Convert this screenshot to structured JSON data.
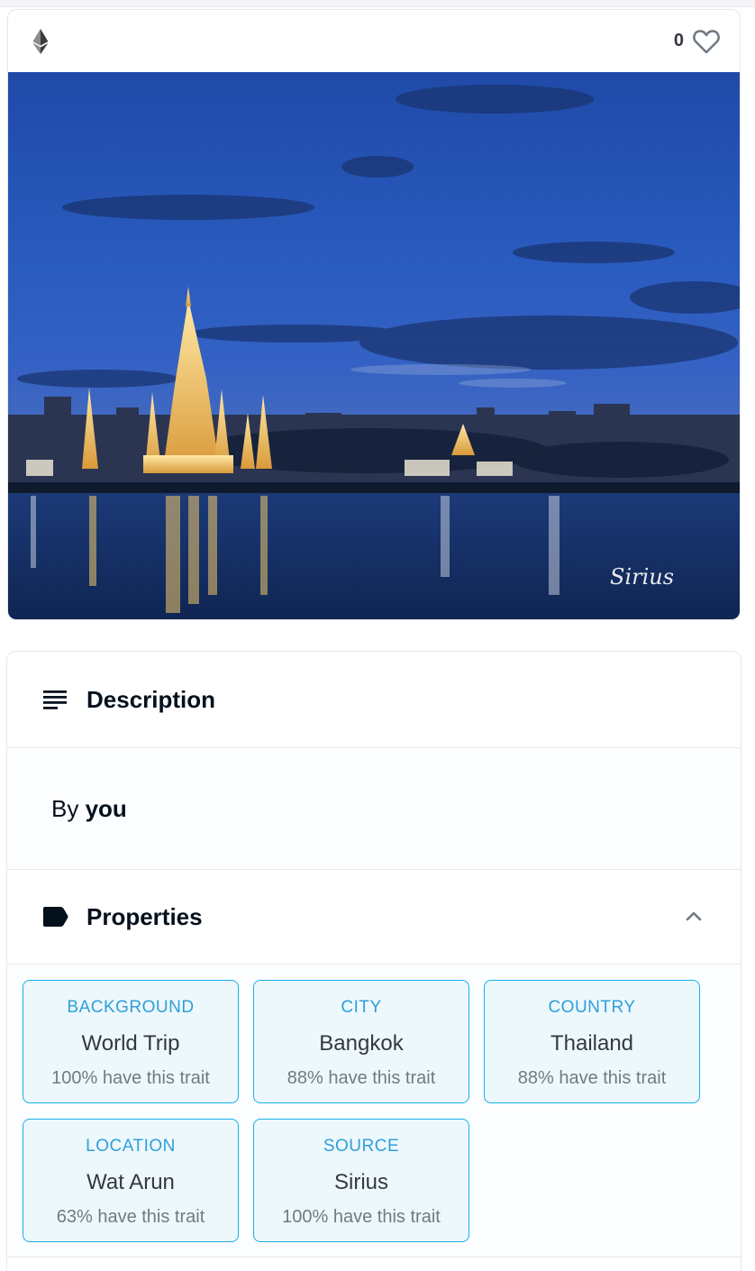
{
  "item": {
    "chain_icon": "ethereum-icon",
    "favorites": {
      "count": "0",
      "icon": "heart-outline-icon"
    },
    "image": {
      "subject": "Wat Arun temple lit at dusk beside the Chao Phraya river",
      "signature": "Sirius"
    }
  },
  "description": {
    "icon": "list-lines-icon",
    "title": "Description",
    "by_label": "By",
    "owner": "you"
  },
  "properties": {
    "icon": "tag-icon",
    "title": "Properties",
    "toggle_icon": "chevron-up-icon",
    "items": [
      {
        "type": "BACKGROUND",
        "value": "World Trip",
        "rarity": "100% have this trait"
      },
      {
        "type": "CITY",
        "value": "Bangkok",
        "rarity": "88% have this trait"
      },
      {
        "type": "COUNTRY",
        "value": "Thailand",
        "rarity": "88% have this trait"
      },
      {
        "type": "LOCATION",
        "value": "Wat Arun",
        "rarity": "63% have this trait"
      },
      {
        "type": "SOURCE",
        "value": "Sirius",
        "rarity": "100% have this trait"
      }
    ]
  },
  "colors": {
    "trait_accent": "#15b2e5",
    "text_primary": "#04111d",
    "text_secondary": "#707a83",
    "border": "#e5e8eb"
  }
}
